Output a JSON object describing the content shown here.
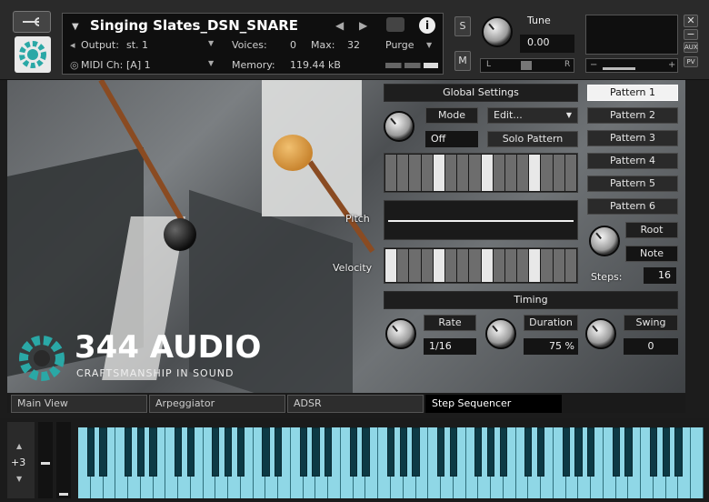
{
  "header": {
    "instrument_name": "Singing Slates_DSN_SNARE",
    "output_label": "Output:",
    "output_value": "st. 1",
    "voices_label": "Voices:",
    "voices_value": "0",
    "max_label": "Max:",
    "max_value": "32",
    "midi_label": "MIDI Ch:",
    "midi_value": "[A]  1",
    "memory_label": "Memory:",
    "memory_value": "119.44 kB",
    "purge_label": "Purge",
    "s_label": "S",
    "m_label": "M",
    "tune_label": "Tune",
    "tune_value": "0.00",
    "pan_left": "L",
    "pan_right": "R",
    "aux_label": "AUX",
    "pv_label": "PV"
  },
  "global": {
    "title": "Global Settings",
    "mode_label": "Mode",
    "mode_value": "Off",
    "edit_label": "Edit...",
    "solo_label": "Solo Pattern",
    "pitch_label": "Pitch",
    "velocity_label": "Velocity"
  },
  "patterns": [
    "Pattern 1",
    "Pattern 2",
    "Pattern 3",
    "Pattern 4",
    "Pattern 5",
    "Pattern 6"
  ],
  "root": {
    "root_label": "Root",
    "note_label": "Note",
    "steps_label": "Steps:",
    "steps_value": "16"
  },
  "timing": {
    "title": "Timing",
    "rate_label": "Rate",
    "rate_value": "1/16",
    "duration_label": "Duration",
    "duration_value": "75",
    "duration_unit": "%",
    "swing_label": "Swing",
    "swing_value": "0"
  },
  "brand": {
    "name": "344 AUDIO",
    "tagline": "CRAFTSMANSHIP IN SOUND"
  },
  "tabs": [
    "Main View",
    "Arpeggiator",
    "ADSR",
    "Step Sequencer"
  ],
  "active_tab": "Step Sequencer",
  "keyboard": {
    "octave_value": "+3"
  },
  "sequencer": {
    "top_steps": [
      0,
      0,
      0,
      0,
      1,
      0,
      0,
      0,
      1,
      0,
      0,
      0,
      1,
      0,
      0,
      0
    ],
    "velocity_steps": [
      1,
      0,
      0,
      0,
      1,
      0,
      0,
      0,
      1,
      0,
      0,
      0,
      1,
      0,
      0,
      0
    ]
  },
  "colors": {
    "accent_teal": "#2aa8a6",
    "key_white": "#8fd7e6",
    "key_black": "#0d3a45",
    "panel_bg": "#2a2a2a"
  }
}
